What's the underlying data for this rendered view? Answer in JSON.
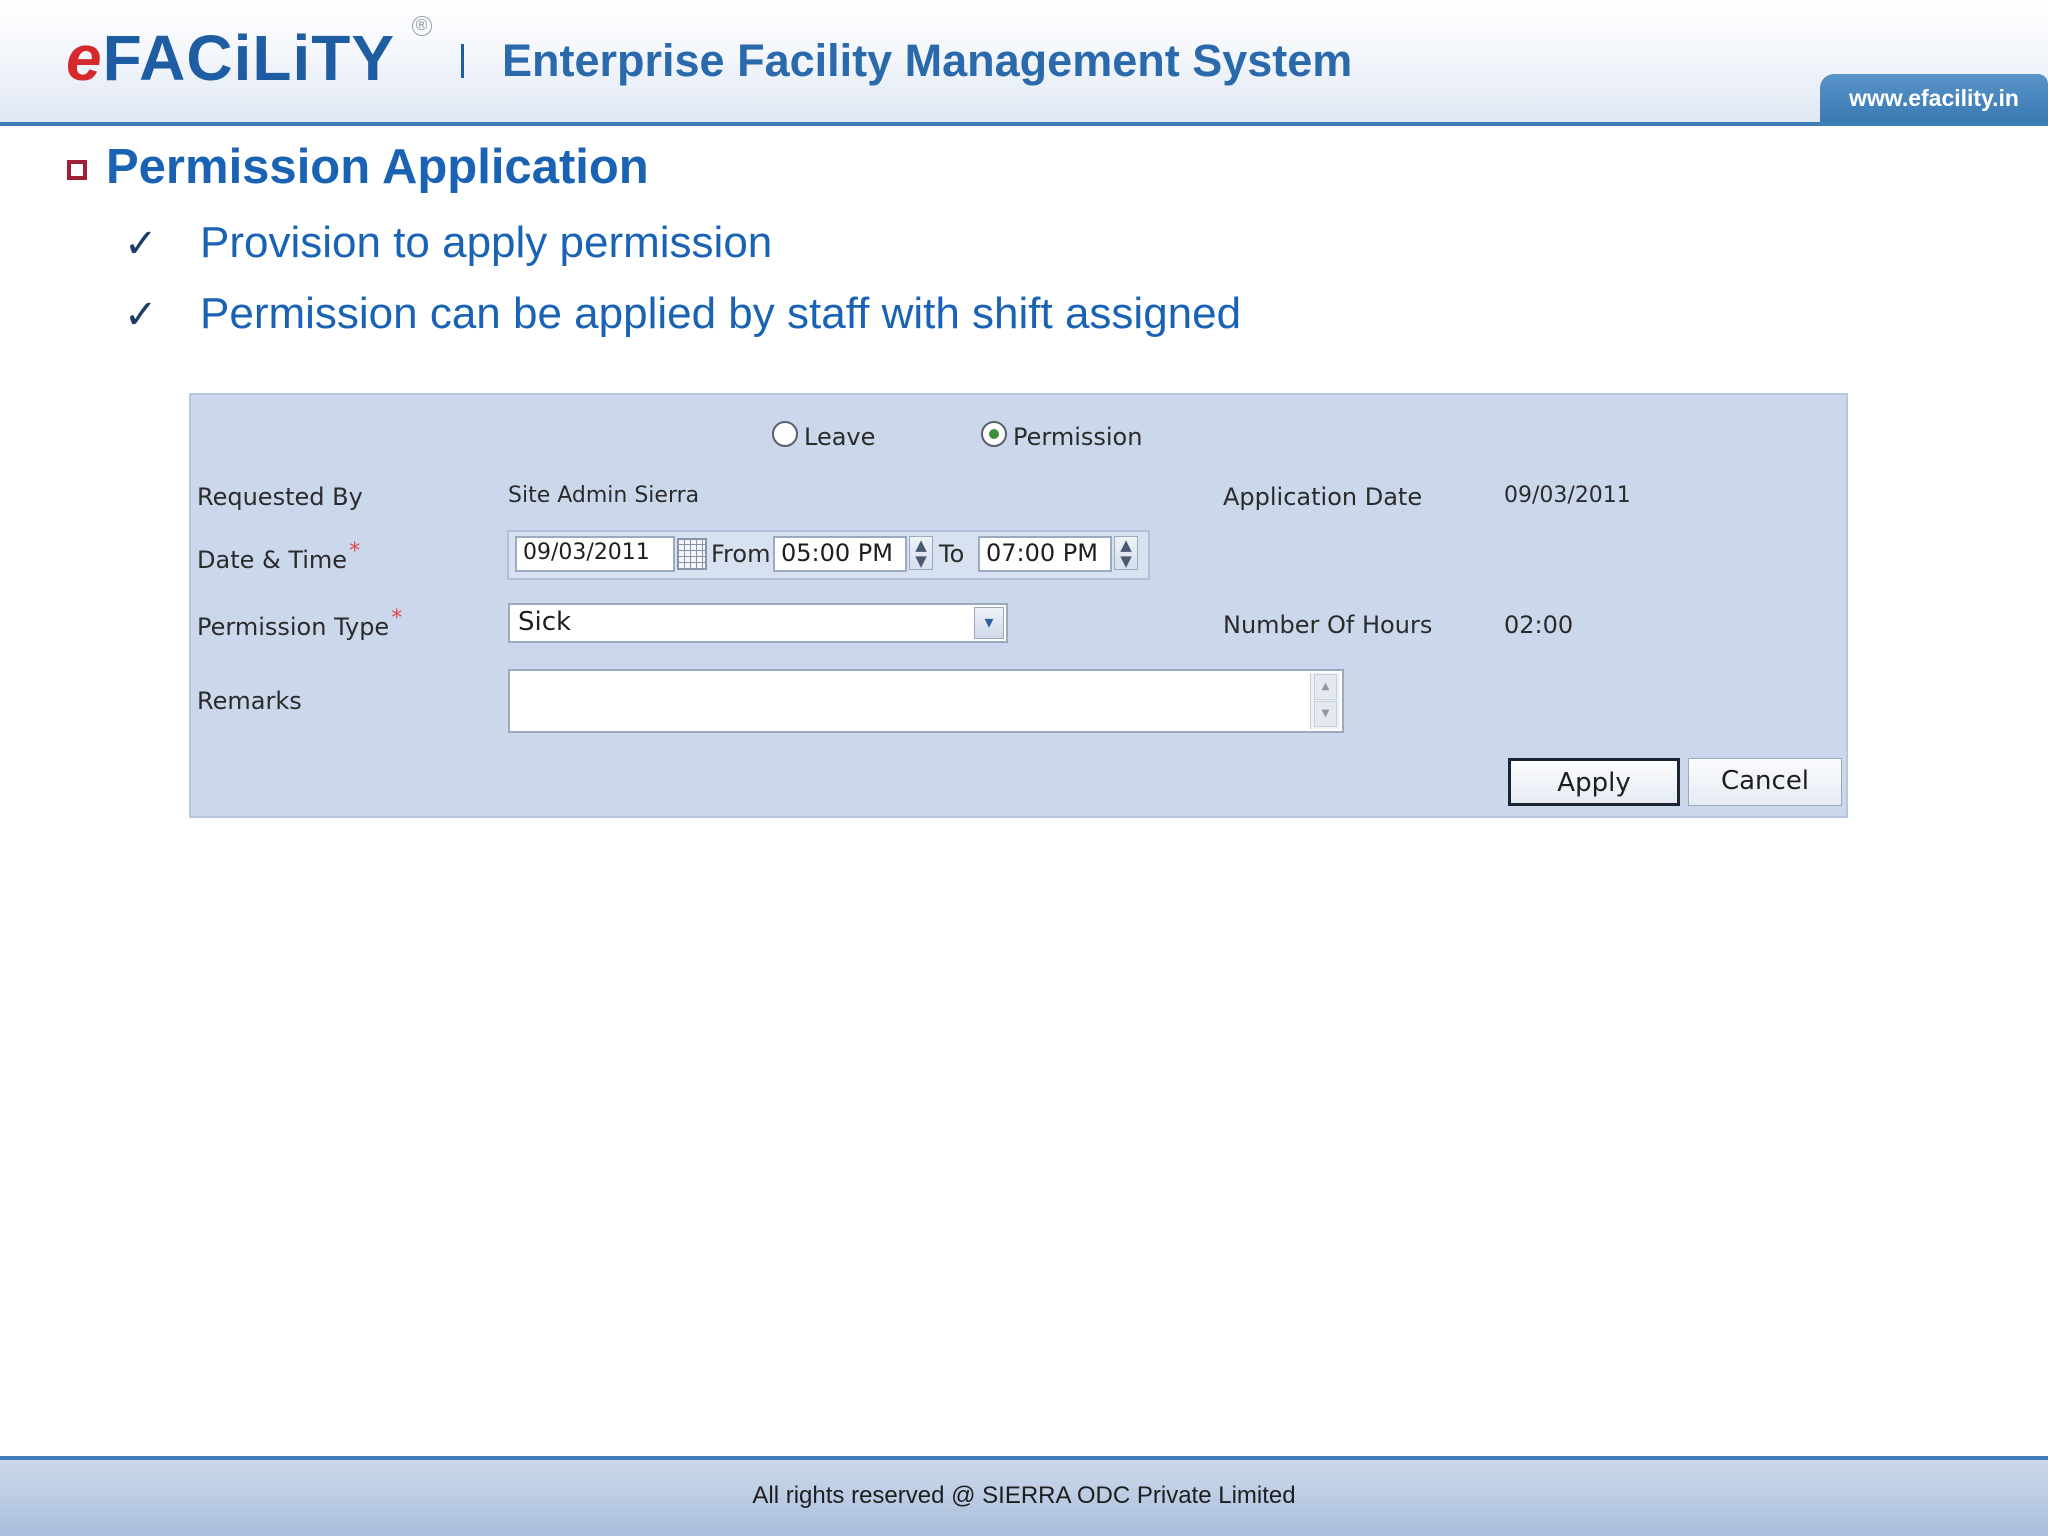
{
  "header": {
    "logo_e": "e",
    "logo_rest": "FACiLiTY",
    "logo_reg": "®",
    "title": "Enterprise Facility Management System",
    "url": "www.efacility.in"
  },
  "slide": {
    "title": "Permission Application",
    "points": [
      "Provision to apply permission",
      "Permission can be applied by staff with shift assigned"
    ],
    "check_glyph": "✓"
  },
  "form": {
    "radios": [
      {
        "label": "Leave",
        "checked": false
      },
      {
        "label": "Permission",
        "checked": true
      }
    ],
    "requested_by_label": "Requested By",
    "requested_by_value": "Site Admin Sierra",
    "application_date_label": "Application Date",
    "application_date_value": "09/03/2011",
    "date_time_label": "Date & Time",
    "date_value": "09/03/2011",
    "from_label": "From",
    "from_value": "05:00 PM",
    "to_label": "To",
    "to_value": "07:00 PM",
    "permission_type_label": "Permission Type",
    "permission_type_value": "Sick",
    "number_of_hours_label": "Number Of Hours",
    "number_of_hours_value": "02:00",
    "remarks_label": "Remarks",
    "remarks_value": "",
    "required_marker": "*",
    "apply_label": "Apply",
    "cancel_label": "Cancel"
  },
  "footer": {
    "text": "All rights reserved @ SIERRA ODC Private Limited"
  },
  "colors": {
    "brand_blue": "#1a63b4",
    "brand_red": "#d42a2e",
    "panel_bg": "#cbd8eb",
    "header_line": "#3f7fb8"
  }
}
